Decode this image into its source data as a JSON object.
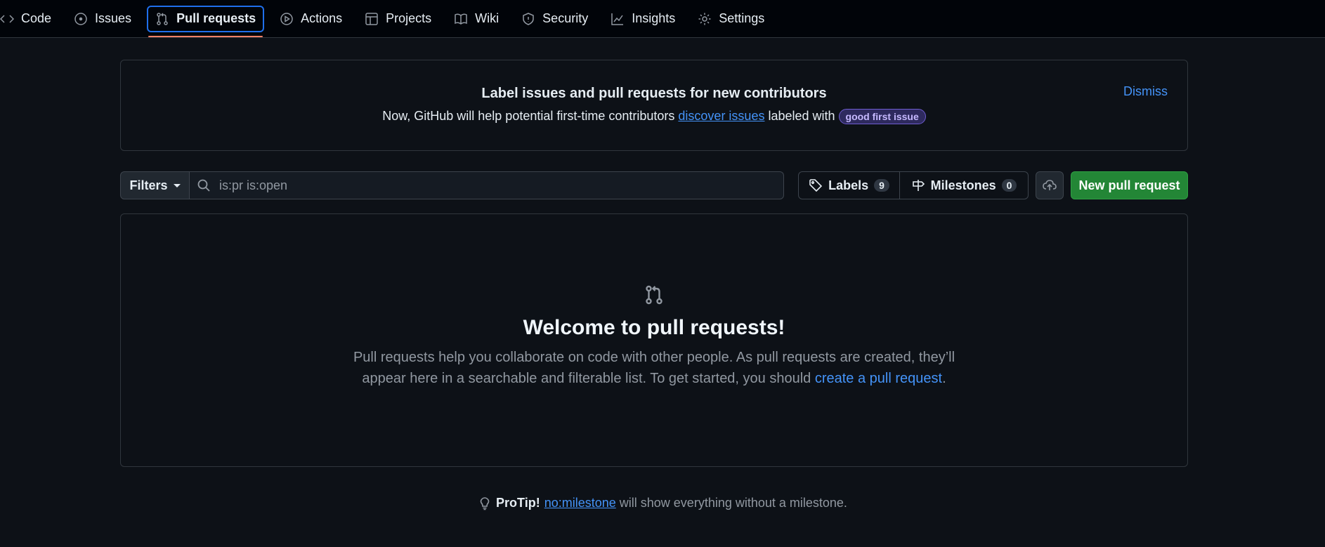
{
  "nav": {
    "tabs": [
      {
        "label": "Code",
        "icon": "code-icon"
      },
      {
        "label": "Issues",
        "icon": "issue-opened-icon"
      },
      {
        "label": "Pull requests",
        "icon": "git-pull-request-icon",
        "active": true
      },
      {
        "label": "Actions",
        "icon": "play-icon"
      },
      {
        "label": "Projects",
        "icon": "table-icon"
      },
      {
        "label": "Wiki",
        "icon": "book-icon"
      },
      {
        "label": "Security",
        "icon": "shield-icon"
      },
      {
        "label": "Insights",
        "icon": "graph-icon"
      },
      {
        "label": "Settings",
        "icon": "gear-icon"
      }
    ]
  },
  "banner": {
    "title": "Label issues and pull requests for new contributors",
    "text_before": "Now, GitHub will help potential first-time contributors ",
    "link": "discover issues",
    "text_after": " labeled with ",
    "label": "good first issue",
    "dismiss": "Dismiss"
  },
  "toolbar": {
    "filters": "Filters",
    "search_placeholder": "is:pr is:open",
    "labels": "Labels",
    "labels_count": "9",
    "milestones": "Milestones",
    "milestones_count": "0",
    "new_pr": "New pull request"
  },
  "blankslate": {
    "title": "Welcome to pull requests!",
    "text": "Pull requests help you collaborate on code with other people. As pull requests are created, they’ll appear here in a searchable and filterable list. To get started, you should ",
    "link": "create a pull request",
    "suffix": "."
  },
  "protip": {
    "label": "ProTip!",
    "link": "no:milestone",
    "text": " will show everything without a milestone."
  },
  "colors": {
    "accent": "#4493f8",
    "primary_button": "#238636",
    "active_underline": "#f78166",
    "background": "#0d1117"
  }
}
